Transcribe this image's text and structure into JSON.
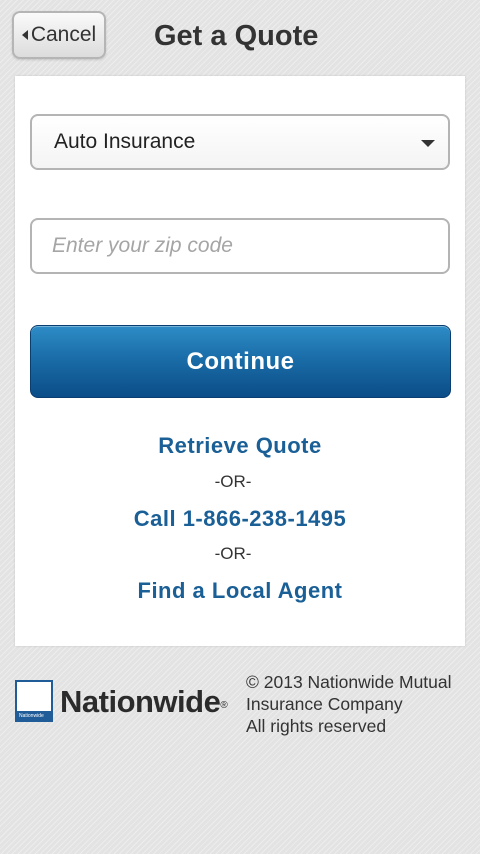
{
  "header": {
    "cancel_label": "Cancel",
    "title": "Get a Quote"
  },
  "form": {
    "insurance_type": "Auto Insurance",
    "zip_placeholder": "Enter your zip code",
    "zip_value": "",
    "continue_label": "Continue"
  },
  "links": {
    "retrieve_quote": "Retrieve Quote",
    "or_1": "-OR-",
    "call": "Call 1-866-238-1495",
    "or_2": "-OR-",
    "find_agent": "Find a Local Agent"
  },
  "footer": {
    "logo_text": "Nationwide",
    "logo_registered": "®",
    "logo_mark_text": "Nationwide",
    "copyright_line1": "© 2013 Nationwide Mutual",
    "copyright_line2": "Insurance Company",
    "copyright_line3": "All rights reserved"
  },
  "colors": {
    "accent_blue": "#1a5f96",
    "button_blue": "#1a6da8",
    "background": "#e3e3e3"
  },
  "icons": {
    "cancel_arrow": "left-triangle-icon",
    "dropdown_caret": "chevron-down-icon"
  }
}
